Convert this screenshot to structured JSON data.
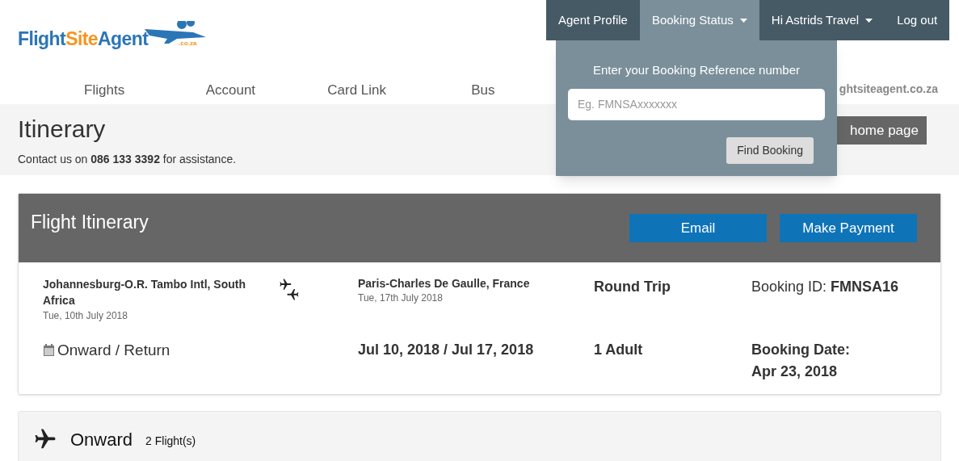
{
  "logo": {
    "parts": [
      {
        "text": "Flight",
        "kind": "main"
      },
      {
        "text": "Site",
        "kind": "accent"
      },
      {
        "text": "Agent",
        "kind": "main"
      }
    ],
    "suffix": ".co.za"
  },
  "top_nav": [
    {
      "label": "Agent Profile",
      "selected": false,
      "caret": false
    },
    {
      "label": "Booking Status",
      "selected": true,
      "caret": true
    },
    {
      "label": "Hi Astrids Travel",
      "selected": false,
      "caret": true
    },
    {
      "label": "Log out",
      "selected": false,
      "caret": false
    }
  ],
  "main_nav": [
    "Flights",
    "Account",
    "Card Link",
    "Bus"
  ],
  "site_link": "ghtsiteagent.co.za",
  "home_button": "home page",
  "dropdown": {
    "label": "Enter your Booking Reference number",
    "placeholder": "Eg. FMNSAxxxxxxx",
    "button": "Find Booking"
  },
  "page": {
    "title": "Itinerary",
    "contact": "Contact us on **086 133 3392** for assistance."
  },
  "itinerary": {
    "title": "Flight Itinerary",
    "buttons": [
      "Email",
      "Make Payment"
    ],
    "from": {
      "place": "Johannesburg-O.R. Tambo Intl, South Africa",
      "date": "Tue, 10th July 2018"
    },
    "to": {
      "place": "Paris-Charles De Gaulle, France",
      "date": "Tue, 17th July 2018"
    },
    "trip_type": "Round Trip",
    "booking_id": "Booking ID: **FMNSA16**",
    "dates_label": "Onward / Return",
    "dates": "Jul 10, 2018 / Jul 17, 2018",
    "passengers": "1 Adult",
    "booking_date_label": "Booking Date:",
    "booking_date": "Apr 23, 2018"
  },
  "onward": {
    "title": "Onward",
    "count": "2 Flight(s)"
  }
}
